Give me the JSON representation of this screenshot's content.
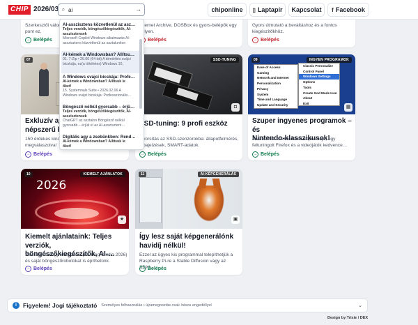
{
  "header": {
    "logo": "CHIP",
    "issue": "2026/03",
    "search_value": "ai",
    "search_go": "→",
    "nav": [
      {
        "label": "chiponline",
        "icon": ""
      },
      {
        "label": "Laptapír",
        "icon": "▯"
      },
      {
        "label": "Kapcsolat",
        "icon": ""
      },
      {
        "label": "Facebook",
        "icon": "f"
      }
    ]
  },
  "suggestions": [
    {
      "title": "AI-asszisztens közvetlenül az asz…",
      "lines": [
        "Teljes verziók, böngészőkiegészítők, AI-",
        "asszisztensek",
        "Microsoft Copilot Windows-alkalmazás AI-",
        "asszisztens közvetlenül az asztalunkon"
      ]
    },
    {
      "title": "AI-kémek a Windowsban? Állítsu…",
      "lines": [
        "01. 7-Zip • 26.00 (64-bit) A tömörítés svájci",
        "bicskája, ez(a tökéletes) Windows 10,"
      ]
    },
    {
      "title": "A Windows svájci bicskája: Profe…",
      "lines": [
        "AI-kémek a Windowsban? Állítsuk le",
        "őket!",
        "15. Systemnals Suite • 2026.02.06 A",
        "Windows svájci bicskája: Professzionális…"
      ]
    },
    {
      "title": "Böngésző nélkül gyorsabb – érjü…",
      "lines": [
        "Teljes verziók, böngészőkiegészítők, AI-",
        "asszisztensek",
        "ChatGPT az asztalon Böngésző nélkül",
        "gyorsabb – érjük el az AI-asszisztent…"
      ]
    },
    {
      "title": "Digitális agy a zsebünkben: Rend…",
      "lines": [
        "AI-kémek a Windowsban? Állítsuk le",
        "őket!"
      ]
    }
  ],
  "cards": [
    {
      "desc": [
        "Szerkesztői válog…",
        "pont ez."
      ],
      "more": "Belépés"
    },
    {
      "desc": [
        "Internet Archive, DOSBox és gyors-belépők egy",
        "helyen."
      ],
      "more": "Belépés"
    },
    {
      "desc": [
        "Gyors útmutató a beváltáshoz és a fontos",
        "kiegészítőkhöz."
      ],
      "more": "Belépés"
    },
    {
      "num": "07",
      "title": [
        "Exkluzív aján…",
        "népszerű kü…"
      ],
      "desc": [
        "150 érdekes kino…",
        "megválaszolva!"
      ],
      "more": "Belépés"
    },
    {
      "tag": "SSD-TUNING",
      "title": [
        "SSD-tuning: 9 profi eszköz"
      ],
      "desc": [
        "Gyorsítás az SSD-szenzorokba: állapotfelmérés,",
        "hibajelzések, SMART-adatok."
      ],
      "more": "Belépés"
    },
    {
      "num": "09",
      "tag": "INGYEN PROGRAMOK",
      "title": [
        "Szuper ingyenes programok – és",
        "Nintendo-klasszikusok!"
      ],
      "desc": [
        "A Windows összes titkos kapcsolója, egy",
        "feltuningolt Firefox és a videójátók kedvence…"
      ],
      "more": "Belépés"
    },
    {
      "num": "10",
      "tag": "KIEMELT AJÁNLATOK",
      "img_text": "2026",
      "title": [
        "Kiemelt ajánlataink: Teljes verziók,",
        "böngészőkiegészítők, AI-…"
      ],
      "desc": [
        "Visszatér a nagy klasszikus (Burning Studio 2026)",
        "és saját böngészőrobotokat is építhetünk."
      ],
      "more": "Belépés"
    },
    {
      "num": "11",
      "tag": "AI-KÉPGENERÁLÁS",
      "title": [
        "Így lesz saját képgenerálónk",
        "havidíj nélkül!"
      ],
      "desc": [
        "Ezzel az ügyes kis programmal telepíthetjük a",
        "Raspberry Pi-re a Stable Diffusion vagy az SDXL…"
      ],
      "more": "Belépés"
    }
  ],
  "winmenu": [
    "Ease of Access",
    "Gaming",
    "Network and Internet",
    "Personalization",
    "Privacy",
    "System",
    "Time and Language",
    "Update and Security"
  ],
  "winmenu2": [
    "Classic Personalize",
    "Control Panel",
    "Windows Settings",
    "Options",
    "Tools",
    "Create God Mode Icon",
    "About",
    "Exit"
  ],
  "footer": {
    "title": "Figyelem! Jogi tájékoztató",
    "sub": "Személyes felhasználás • újramegosztás csak írásos engedéllyel",
    "credit": "Design by Trixie / DEX"
  }
}
